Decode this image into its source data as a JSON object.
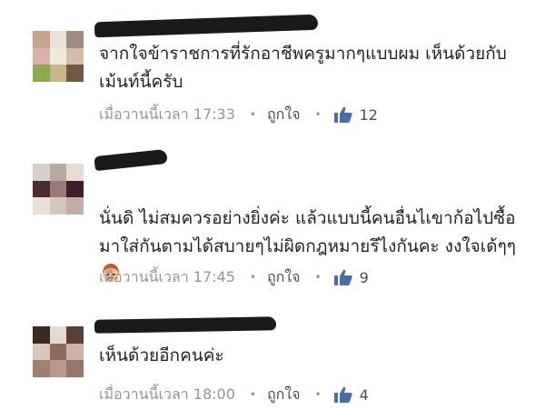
{
  "comments": [
    {
      "text": "จากใจข้าราชการที่รักอาชีพครูมากๆแบบผม เห็นด้วยกับเม้นท์นี้ครับ",
      "time": "เมื่อวานนี้เวลา 17:33",
      "like_label": "ถูกใจ",
      "like_count": "12",
      "name_icon": "redacted-name"
    },
    {
      "text": "นั่นดิ ไม่สมควรอย่างยิ่งค่ะ แล้วแบบนี้คนอื่นไเขาก้อไปซื้อมาใส่กันตามได้สบายๆไม่ผิดกฎหมายรึไงกันคะ งงใจเด้ๆๆ",
      "time": "เมื่อวานนี้เวลา 17:45",
      "like_label": "ถูกใจ",
      "like_count": "9",
      "emoji_icon": "confused-girl-emoji"
    },
    {
      "text": "เห็นด้วยอีกคนค่ะ",
      "time": "เมื่อวานนี้เวลา 18:00",
      "like_label": "ถูกใจ",
      "like_count": "4"
    }
  ],
  "colors": {
    "meta": "#90949c",
    "thumb": "#4b6ca8",
    "text": "#1d2129"
  }
}
